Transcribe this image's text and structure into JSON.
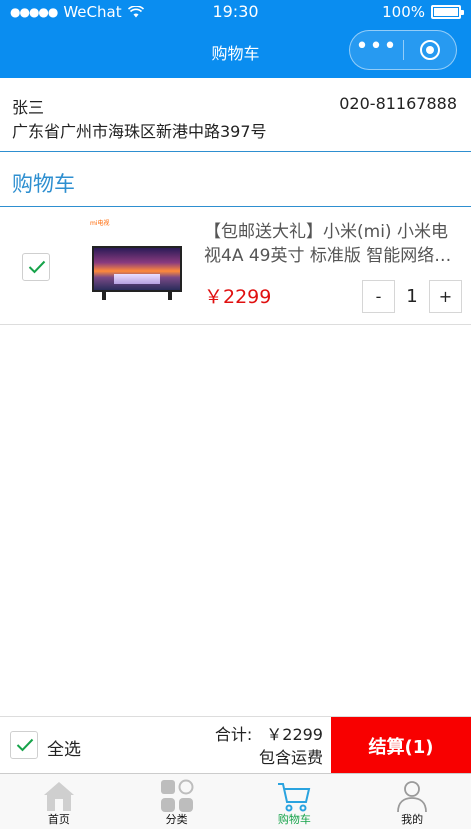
{
  "status_bar": {
    "carrier": "WeChat",
    "time": "19:30",
    "battery": "100%"
  },
  "nav": {
    "title": "购物车"
  },
  "address": {
    "name": "张三",
    "phone": "020-81167888",
    "detail": "广东省广州市海珠区新港中路397号"
  },
  "section": {
    "title": "购物车"
  },
  "cart": {
    "items": [
      {
        "title": "【包邮送大礼】小米(mi) 小米电视4A 49英寸 标准版 智能网络…",
        "brand": "mi电视",
        "price": "￥2299",
        "quantity": "1",
        "checked": true
      }
    ]
  },
  "stepper": {
    "minus": "-",
    "plus": "+"
  },
  "footer": {
    "select_all": "全选",
    "total_label": "合计:",
    "total_amount": "￥2299",
    "freight": "包含运费",
    "checkout": "结算(1)"
  },
  "tabbar": [
    {
      "label": "首页",
      "icon": "home-icon"
    },
    {
      "label": "分类",
      "icon": "category-icon"
    },
    {
      "label": "购物车",
      "icon": "cart-icon",
      "active": true
    },
    {
      "label": "我的",
      "icon": "user-icon"
    }
  ],
  "colors": {
    "primary": "#0a8df0",
    "accent_blue": "#2e8fd0",
    "price": "#e01010",
    "checkout": "#f80000",
    "active_tab": "#16a34a"
  }
}
